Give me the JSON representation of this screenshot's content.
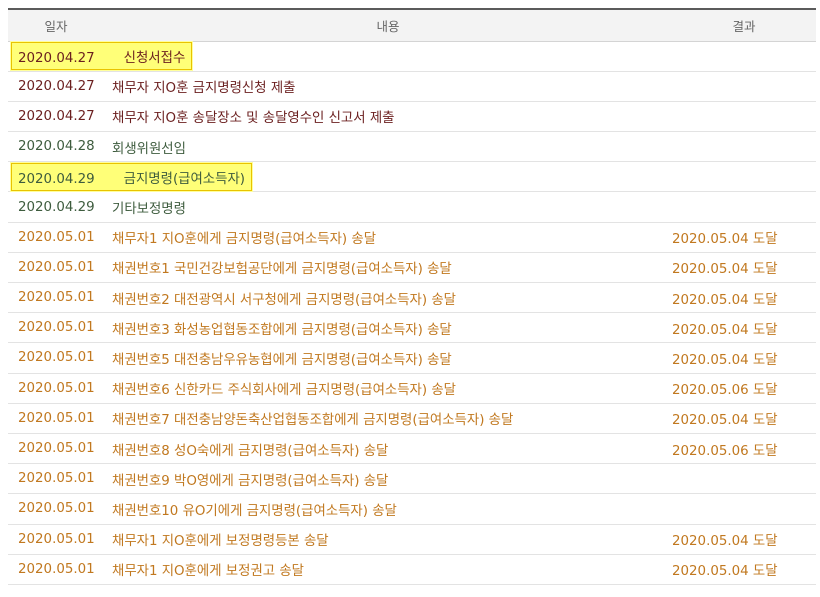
{
  "header": {
    "date": "일자",
    "content": "내용",
    "result": "결과"
  },
  "colors": {
    "dark": "#6b1f1f",
    "green": "#3e5c3e",
    "orange": "#c1781f",
    "highlight": "#ffff78"
  },
  "rows": [
    {
      "date": "2020.04.27",
      "content": "신청서접수",
      "result": "",
      "kind": "dark",
      "highlight": true
    },
    {
      "date": "2020.04.27",
      "content": "채무자 지O훈 금지명령신청 제출",
      "result": "",
      "kind": "dark"
    },
    {
      "date": "2020.04.27",
      "content": "채무자 지O훈 송달장소 및 송달영수인 신고서 제출",
      "result": "",
      "kind": "dark"
    },
    {
      "date": "2020.04.28",
      "content": "회생위원선임",
      "result": "",
      "kind": "green"
    },
    {
      "date": "2020.04.29",
      "content": "금지명령(급여소득자)",
      "result": "",
      "kind": "green",
      "highlight": true
    },
    {
      "date": "2020.04.29",
      "content": "기타보정명령",
      "result": "",
      "kind": "green"
    },
    {
      "date": "2020.05.01",
      "content": "채무자1 지O훈에게 금지명령(급여소득자) 송달",
      "result": "2020.05.04 도달",
      "kind": "orange"
    },
    {
      "date": "2020.05.01",
      "content": "채권번호1 국민건강보험공단에게 금지명령(급여소득자) 송달",
      "result": "2020.05.04 도달",
      "kind": "orange"
    },
    {
      "date": "2020.05.01",
      "content": "채권번호2 대전광역시 서구청에게 금지명령(급여소득자) 송달",
      "result": "2020.05.04 도달",
      "kind": "orange"
    },
    {
      "date": "2020.05.01",
      "content": "채권번호3 화성농업협동조합에게 금지명령(급여소득자) 송달",
      "result": "2020.05.04 도달",
      "kind": "orange"
    },
    {
      "date": "2020.05.01",
      "content": "채권번호5 대전충남우유농협에게 금지명령(급여소득자) 송달",
      "result": "2020.05.04 도달",
      "kind": "orange"
    },
    {
      "date": "2020.05.01",
      "content": "채권번호6 신한카드 주식회사에게 금지명령(급여소득자) 송달",
      "result": "2020.05.06 도달",
      "kind": "orange"
    },
    {
      "date": "2020.05.01",
      "content": "채권번호7 대전충남양돈축산업협동조합에게 금지명령(급여소득자) 송달",
      "result": "2020.05.04 도달",
      "kind": "orange"
    },
    {
      "date": "2020.05.01",
      "content": "채권번호8 성O숙에게 금지명령(급여소득자) 송달",
      "result": "2020.05.06 도달",
      "kind": "orange"
    },
    {
      "date": "2020.05.01",
      "content": "채권번호9 박O영에게 금지명령(급여소득자) 송달",
      "result": "",
      "kind": "orange"
    },
    {
      "date": "2020.05.01",
      "content": "채권번호10 유O기에게 금지명령(급여소득자) 송달",
      "result": "",
      "kind": "orange"
    },
    {
      "date": "2020.05.01",
      "content": "채무자1 지O훈에게 보정명령등본 송달",
      "result": "2020.05.04 도달",
      "kind": "orange"
    },
    {
      "date": "2020.05.01",
      "content": "채무자1 지O훈에게 보정권고 송달",
      "result": "2020.05.04 도달",
      "kind": "orange"
    }
  ]
}
